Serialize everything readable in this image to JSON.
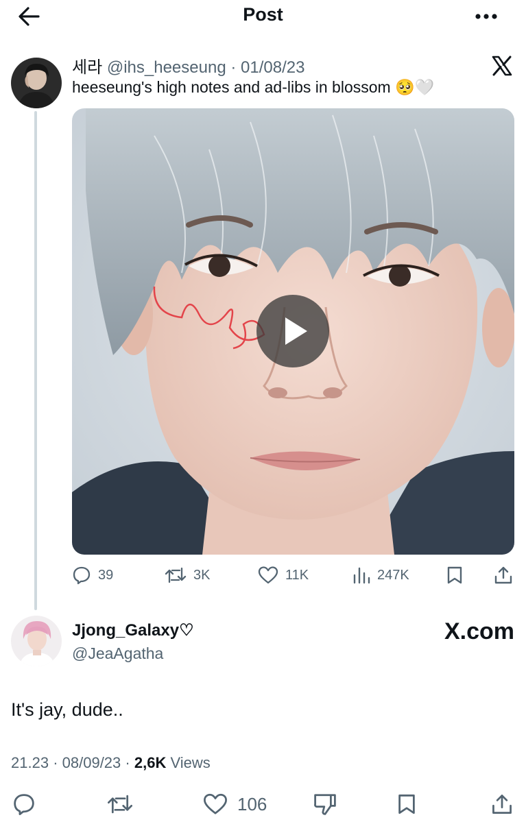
{
  "header": {
    "title": "Post",
    "back_icon": "arrow-left-icon",
    "more_icon": "more-horizontal-icon"
  },
  "quoted_tweet": {
    "display_name": "세라",
    "handle": "@ihs_heeseung",
    "separator": "·",
    "date": "01/08/23",
    "text": "heeseung's high notes and ad-libs in blossom",
    "emojis": "🥺🤍",
    "media_type": "video",
    "actions": {
      "replies": "39",
      "reposts": "3K",
      "likes": "11K",
      "views": "247K"
    }
  },
  "reply": {
    "display_name": "Jjong_Galaxy♡",
    "handle": "@JeaAgatha",
    "watermark": "X.com",
    "text": "It's jay, dude..",
    "time": "21.23",
    "separator": "·",
    "date": "08/09/23",
    "separator2": "·",
    "views_count": "2,6K",
    "views_label": "Views",
    "actions": {
      "likes": "106"
    }
  },
  "colors": {
    "text_primary": "#0f1419",
    "text_secondary": "#536471",
    "thread_line": "#cfd9de"
  }
}
